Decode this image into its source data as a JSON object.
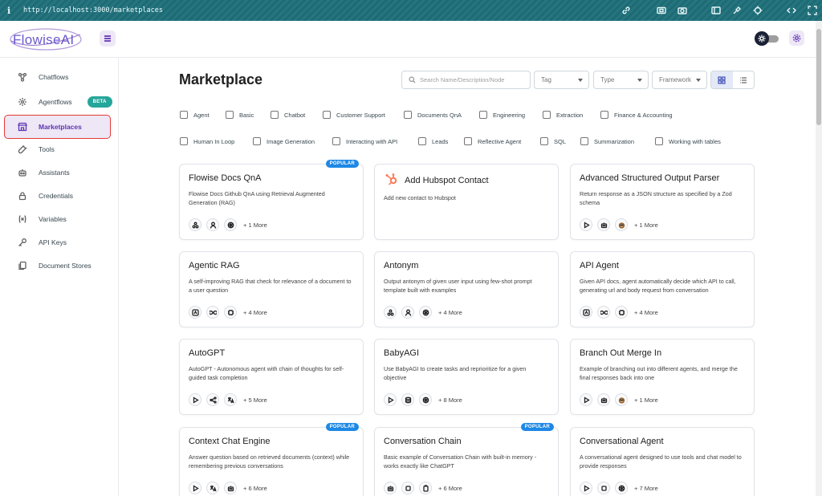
{
  "browser": {
    "url": "http://localhost:3000/marketplaces"
  },
  "brand": {
    "logo_text": "FlowiseAI",
    "accent": "#673ab7",
    "active_outline": "#e53935"
  },
  "sidebar": {
    "items": [
      {
        "label": "Chatflows",
        "icon": "chatflows-icon"
      },
      {
        "label": "Agentflows",
        "icon": "agentflows-icon",
        "badge": "BETA"
      },
      {
        "label": "Marketplaces",
        "icon": "marketplace-icon",
        "active": true
      },
      {
        "label": "Tools",
        "icon": "tools-icon"
      },
      {
        "label": "Assistants",
        "icon": "robot-icon"
      },
      {
        "label": "Credentials",
        "icon": "lock-icon"
      },
      {
        "label": "Variables",
        "icon": "variable-icon"
      },
      {
        "label": "API Keys",
        "icon": "key-icon"
      },
      {
        "label": "Document Stores",
        "icon": "files-icon"
      }
    ]
  },
  "main": {
    "title": "Marketplace",
    "search_placeholder": "Search Name/Description/Node",
    "filters": {
      "tag": "Tag",
      "type": "Type",
      "framework": "Framework"
    },
    "tags_row1": [
      "Agent",
      "Basic",
      "Chatbot",
      "Customer Support",
      "Documents QnA",
      "Engineering",
      "Extraction",
      "Finance & Accounting"
    ],
    "tags_row2": [
      "Human In Loop",
      "Image Generation",
      "Interacting with API",
      "Leads",
      "Reflective Agent",
      "SQL",
      "Summarization",
      "Working with tables"
    ],
    "cards": [
      {
        "title": "Flowise Docs QnA",
        "desc": "Flowise Docs Github QnA using Retrieval Augmented Generation (RAG)",
        "more": "+ 1 More",
        "badge": "POPULAR",
        "icons": [
          "nodes-icon",
          "person-icon",
          "openai-icon"
        ]
      },
      {
        "title": "Add Hubspot Contact",
        "desc": "Add new contact to Hubspot",
        "more": "",
        "icons": []
      },
      {
        "title": "Advanced Structured Output Parser",
        "desc": "Return response as a JSON structure as specified by a Zod schema",
        "more": "+ 1 More",
        "icons": [
          "play-icon",
          "robot-icon",
          "ollama-icon"
        ]
      },
      {
        "title": "Agentic RAG",
        "desc": "A self-improving RAG that check for relevance of a document to a user question",
        "more": "+ 4 More",
        "icons": [
          "condition-icon",
          "loop-icon",
          "chip-icon"
        ]
      },
      {
        "title": "Antonym",
        "desc": "Output antonym of given user input using few-shot prompt template built with examples",
        "more": "+ 4 More",
        "icons": [
          "nodes-icon",
          "person-icon",
          "openai-icon"
        ]
      },
      {
        "title": "API Agent",
        "desc": "Given API docs, agent automatically decide which API to call, generating url and body request from conversation",
        "more": "+ 4 More",
        "icons": [
          "condition-icon",
          "loop-icon",
          "chip-icon"
        ]
      },
      {
        "title": "AutoGPT",
        "desc": "AutoGPT - Autonomous agent with chain of thoughts for self-guided task completion",
        "more": "+ 5 More",
        "icons": [
          "play-icon",
          "share-icon",
          "translate-icon"
        ]
      },
      {
        "title": "BabyAGI",
        "desc": "Use BabyAGI to create tasks and reprioritize for a given objective",
        "more": "+ 8 More",
        "icons": [
          "play-icon",
          "database-icon",
          "openai-icon"
        ]
      },
      {
        "title": "Branch Out Merge In",
        "desc": "Example of branching out into different agents, and merge the final responses back into one",
        "more": "+ 1 More",
        "icons": [
          "play-icon",
          "robot-icon",
          "ollama-icon"
        ]
      },
      {
        "title": "Context Chat Engine",
        "desc": "Answer question based on retrieved documents (context) while remembering previous conversations",
        "more": "+ 6 More",
        "badge": "POPULAR",
        "icons": [
          "play-icon",
          "translate-icon",
          "robot-icon"
        ]
      },
      {
        "title": "Conversation Chain",
        "desc": "Basic example of Conversation Chain with built-in memory - works exactly like ChatGPT",
        "more": "+ 6 More",
        "badge": "POPULAR",
        "icons": [
          "robot-icon",
          "stop-icon",
          "clipboard-icon"
        ]
      },
      {
        "title": "Conversational Agent",
        "desc": "A conversational agent designed to use tools and chat model to provide responses",
        "more": "+ 7 More",
        "icons": [
          "play-icon",
          "stop-icon",
          "openai-icon"
        ]
      }
    ]
  }
}
